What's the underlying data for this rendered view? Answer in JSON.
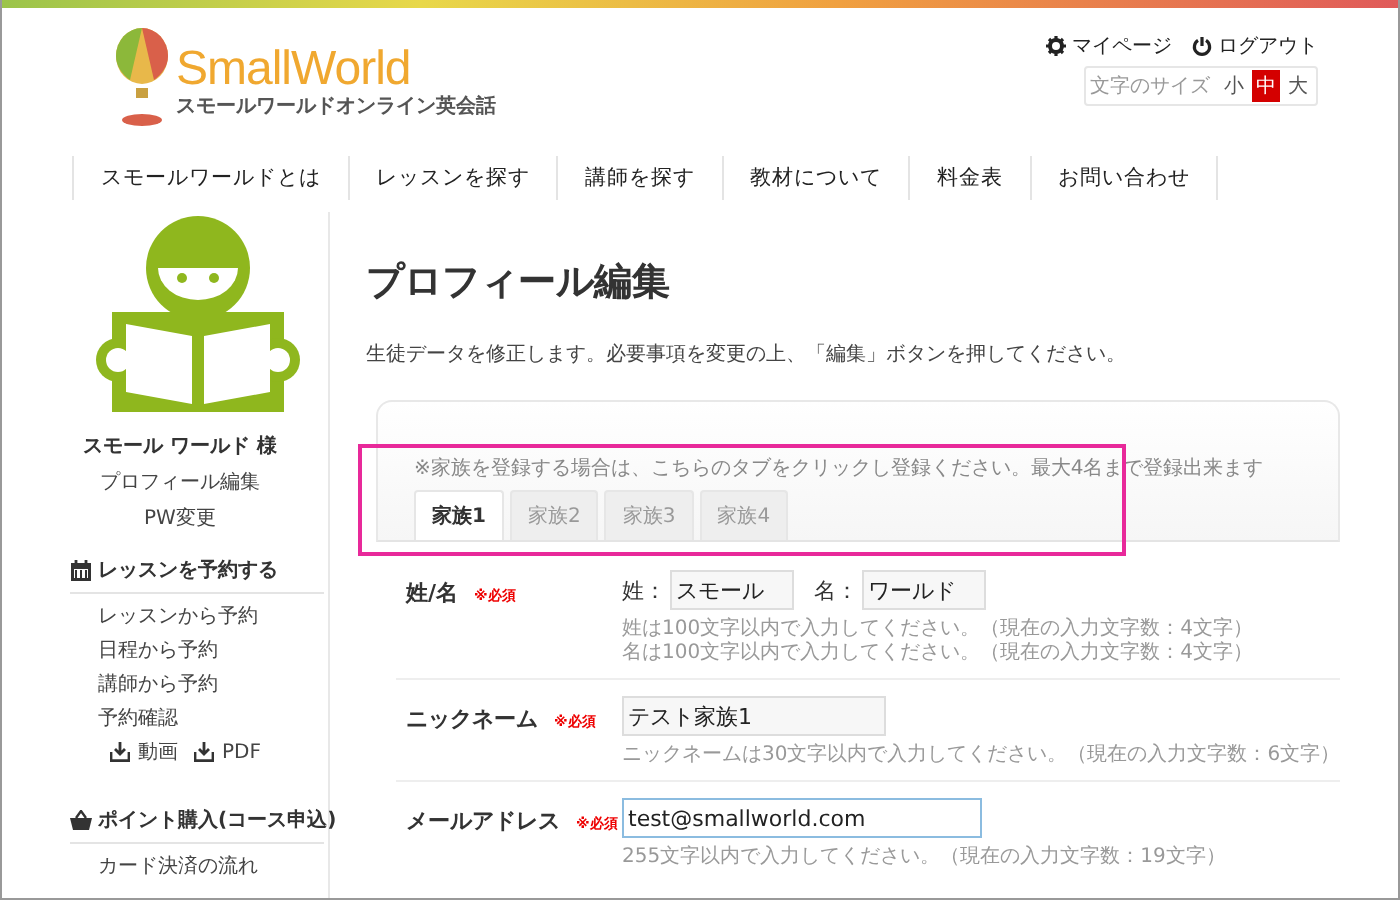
{
  "logo": {
    "name": "SmallWorld",
    "tagline": "スモールワールドオンライン英会話"
  },
  "top_links": [
    {
      "kind": "settings",
      "label": "マイページ"
    },
    {
      "kind": "power",
      "label": "ログアウト"
    }
  ],
  "font_size": {
    "label": "文字のサイズ",
    "options": [
      {
        "label": "小",
        "selected": false
      },
      {
        "label": "中",
        "selected": true
      },
      {
        "label": "大",
        "selected": false
      }
    ]
  },
  "nav": [
    "スモールワールドとは",
    "レッスンを探す",
    "講師を探す",
    "教材について",
    "料金表",
    "お問い合わせ"
  ],
  "sidebar": {
    "user_name": "スモール ワールド 様",
    "links": [
      "プロフィール編集",
      "PW変更"
    ],
    "sections": [
      {
        "kind": "calendar",
        "title": "レッスンを予約する",
        "items": [
          "レッスンから予約",
          "日程から予約",
          "講師から予約",
          "予約確認"
        ],
        "downloads": [
          "動画",
          "PDF"
        ]
      },
      {
        "kind": "basket",
        "title": "ポイント購入(コース申込)",
        "items": [
          "カード決済の流れ"
        ]
      }
    ]
  },
  "main": {
    "title": "プロフィール編集",
    "description": "生徒データを修正します。必要事項を変更の上、「編集」ボタンを押してください。",
    "card": {
      "note": "※家族を登録する場合は、こちらのタブをクリックし登録ください。最大4名まで登録出来ます",
      "highlighted": true,
      "tabs": [
        {
          "label": "家族1",
          "selected": true
        },
        {
          "label": "家族2",
          "selected": false
        },
        {
          "label": "家族3",
          "selected": false
        },
        {
          "label": "家族4",
          "selected": false
        }
      ]
    },
    "fields": [
      {
        "label": "姓/名",
        "required": "※必須",
        "focused": false,
        "inputs": [
          {
            "prefix": "姓：",
            "value": "スモール"
          },
          {
            "prefix": "名：",
            "value": "ワールド"
          }
        ],
        "hints": [
          "姓は100文字以内で入力してください。（現在の入力文字数：4文字）",
          "名は100文字以内で入力してください。（現在の入力文字数：4文字）"
        ]
      },
      {
        "label": "ニックネーム",
        "required": "※必須",
        "focused": false,
        "inputs": [
          {
            "value": "テスト家族1"
          }
        ],
        "hints": [
          "ニックネームは30文字以内で入力してください。（現在の入力文字数：6文字）"
        ]
      },
      {
        "label": "メールアドレス",
        "required": "※必須",
        "focused": true,
        "inputs": [
          {
            "value": "test@smallworld.com"
          }
        ],
        "hints": [
          "255文字以内で入力してください。（現在の入力文字数：19文字）"
        ]
      }
    ]
  }
}
